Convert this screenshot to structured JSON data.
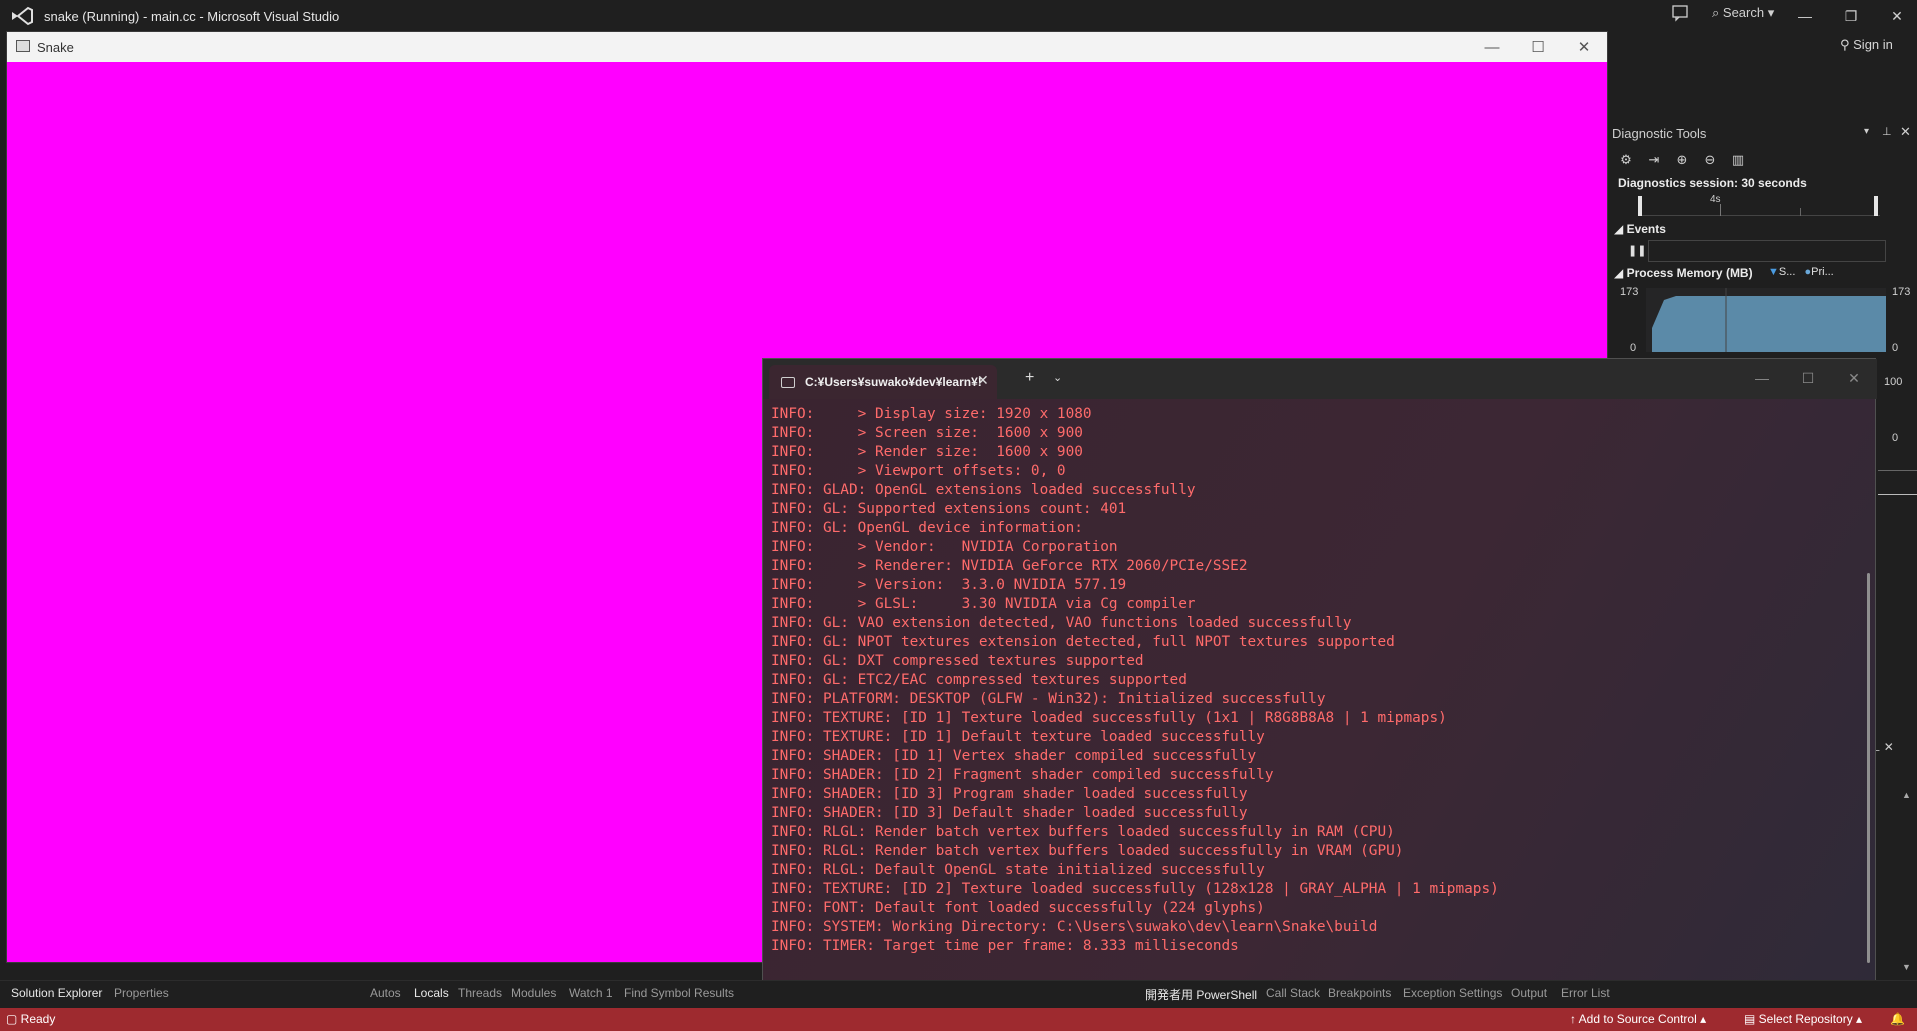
{
  "vs": {
    "title": "snake (Running) - main.cc - Microsoft Visual Studio",
    "search_label": "Search",
    "sign_in": "Sign in",
    "icons": [
      "vs-logo",
      "feedback-icon",
      "search-icon",
      "minimize-icon",
      "restore-icon",
      "close-icon"
    ]
  },
  "snake": {
    "title": "Snake",
    "background": "#ff00ff"
  },
  "diagnostics": {
    "title": "Diagnostic Tools",
    "session": "Diagnostics session: 30 seconds",
    "ruler_label": "4s",
    "events_title": "Events",
    "memory_title": "Process Memory (MB)",
    "legend": [
      "S...",
      "Pri..."
    ],
    "mem_max_left": "173",
    "mem_min_left": "0",
    "mem_max_right": "173",
    "mem_min_right": "0",
    "cpu_max": "100",
    "cpu_min": "0"
  },
  "terminal": {
    "tab_title": "C:¥Users¥suwako¥dev¥learn¥!",
    "lines": [
      "INFO:     > Display size: 1920 x 1080",
      "INFO:     > Screen size:  1600 x 900",
      "INFO:     > Render size:  1600 x 900",
      "INFO:     > Viewport offsets: 0, 0",
      "INFO: GLAD: OpenGL extensions loaded successfully",
      "INFO: GL: Supported extensions count: 401",
      "INFO: GL: OpenGL device information:",
      "INFO:     > Vendor:   NVIDIA Corporation",
      "INFO:     > Renderer: NVIDIA GeForce RTX 2060/PCIe/SSE2",
      "INFO:     > Version:  3.3.0 NVIDIA 577.19",
      "INFO:     > GLSL:     3.30 NVIDIA via Cg compiler",
      "INFO: GL: VAO extension detected, VAO functions loaded successfully",
      "INFO: GL: NPOT textures extension detected, full NPOT textures supported",
      "INFO: GL: DXT compressed textures supported",
      "INFO: GL: ETC2/EAC compressed textures supported",
      "INFO: PLATFORM: DESKTOP (GLFW - Win32): Initialized successfully",
      "INFO: TEXTURE: [ID 1] Texture loaded successfully (1x1 | R8G8B8A8 | 1 mipmaps)",
      "INFO: TEXTURE: [ID 1] Default texture loaded successfully",
      "INFO: SHADER: [ID 1] Vertex shader compiled successfully",
      "INFO: SHADER: [ID 2] Fragment shader compiled successfully",
      "INFO: SHADER: [ID 3] Program shader loaded successfully",
      "INFO: SHADER: [ID 3] Default shader loaded successfully",
      "INFO: RLGL: Render batch vertex buffers loaded successfully in RAM (CPU)",
      "INFO: RLGL: Render batch vertex buffers loaded successfully in VRAM (GPU)",
      "INFO: RLGL: Default OpenGL state initialized successfully",
      "INFO: TEXTURE: [ID 2] Texture loaded successfully (128x128 | GRAY_ALPHA | 1 mipmaps)",
      "INFO: FONT: Default font loaded successfully (224 glyphs)",
      "INFO: SYSTEM: Working Directory: C:\\Users\\suwako\\dev\\learn\\Snake\\build",
      "INFO: TIMER: Target time per frame: 8.333 milliseconds"
    ],
    "text_color": "#ff6b6b"
  },
  "bottom_tabs": {
    "solution_explorer": "Solution Explorer",
    "properties": "Properties",
    "autos": "Autos",
    "locals": "Locals",
    "threads": "Threads",
    "modules": "Modules",
    "watch1": "Watch 1",
    "find_symbol": "Find Symbol Results",
    "powershell": "開発者用 PowerShell",
    "call_stack": "Call Stack",
    "breakpoints": "Breakpoints",
    "exception_settings": "Exception Settings",
    "output": "Output",
    "error_list": "Error List"
  },
  "status": {
    "ready": "Ready",
    "add_source_control": "Add to Source Control",
    "select_repository": "Select Repository",
    "bar_color": "#9e2a2f"
  }
}
